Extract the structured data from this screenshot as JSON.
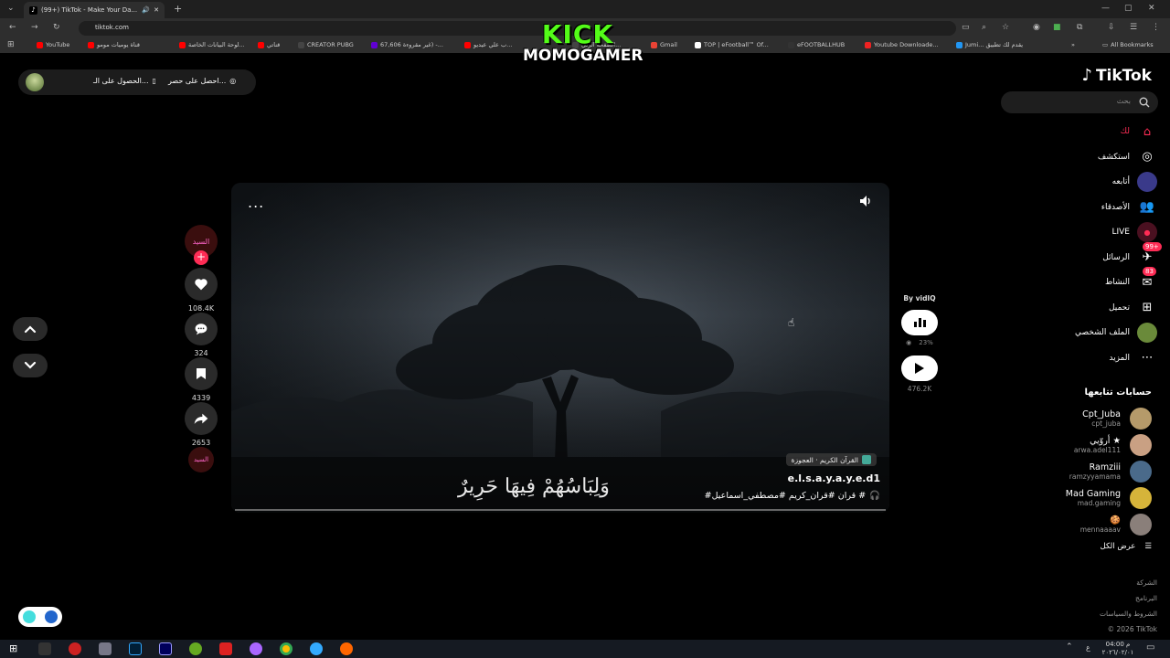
{
  "browser": {
    "tab_title": "(99+) TikTok - Make Your Da...",
    "url": "tiktok.com",
    "bookmarks": [
      {
        "label": "YouTube",
        "color": "#ff0000"
      },
      {
        "label": "قناة يوميات مومو",
        "color": "#ff0000"
      },
      {
        "label": "لوحة البيانات الخاصة...",
        "color": "#ff0000"
      },
      {
        "label": "قناتي",
        "color": "#ff0000"
      },
      {
        "label": "CREATOR PUBG",
        "color": "#444444"
      },
      {
        "label": "67,606 غير مقروءة) -...",
        "color": "#6001d2"
      },
      {
        "label": "ب علي عيديو...",
        "color": "#ff0000"
      },
      {
        "label": "الصفحة الرئي...",
        "color": "#444444"
      },
      {
        "label": "Gmail",
        "color": "#ea4335"
      },
      {
        "label": "TOP | eFootball™ Of...",
        "color": "#ffffff"
      },
      {
        "label": "eFOOTBALLHUB",
        "color": "#333333"
      },
      {
        "label": "Youtube Downloade...",
        "color": "#e22"
      },
      {
        "label": "Jumi... يقدم لك تطبيق",
        "color": "#2196f3"
      }
    ],
    "all_bookmarks": "All Bookmarks"
  },
  "overlay": {
    "kick_text": "KICK",
    "gamer_text": "MOMOGAMER"
  },
  "top_bar": {
    "item1": "احصل على حصر...",
    "item2": "الحصول على الـ..."
  },
  "video": {
    "hashtag_chip": "القرآن الكريم · العجوزة",
    "username": "e.l.s.a.y.a.y.e.d1",
    "caption": "#قران #قران_كريم #مصطفي_اسماعيل #",
    "arabic_overlay": "وَلِبَاسُهُمْ فِيهَا حَرِيرٌ",
    "more_label": "..."
  },
  "actions": {
    "creator_label": "السيد",
    "likes": "108.4K",
    "comments": "324",
    "saves": "4339",
    "shares": "2653",
    "music_label": "السيد"
  },
  "vidiq": {
    "by_label": "By vidIQ",
    "percent": "23%",
    "views": "476.2K"
  },
  "sidebar": {
    "logo": "TikTok",
    "search_placeholder": "بحث",
    "nav": [
      {
        "label": "لك",
        "icon": "home-icon",
        "active": true
      },
      {
        "label": "استكشف",
        "icon": "compass-icon"
      },
      {
        "label": "أتابعه",
        "icon": "following-icon"
      },
      {
        "label": "الأصدقاء",
        "icon": "friends-icon"
      },
      {
        "label": "LIVE",
        "icon": "live-icon"
      },
      {
        "label": "الرسائل",
        "icon": "messages-icon",
        "badge": "99+"
      },
      {
        "label": "النشاط",
        "icon": "activity-icon",
        "badge": "83"
      },
      {
        "label": "تحميل",
        "icon": "upload-icon"
      },
      {
        "label": "الملف الشخصي",
        "icon": "profile-icon"
      },
      {
        "label": "المزيد",
        "icon": "more-icon"
      }
    ],
    "following_title": "حسابات تتابعها",
    "following": [
      {
        "name": "Cpt_Juba",
        "handle": "cpt_juba",
        "color": "#b59a6a"
      },
      {
        "name": "أروّيي ★",
        "handle": "arwa.adel111",
        "color": "#c9a083"
      },
      {
        "name": "Ramziii",
        "handle": "ramzyyamama",
        "color": "#4a6a8a"
      },
      {
        "name": "Mad Gaming",
        "handle": "mad.gaming",
        "color": "#d6b43a"
      },
      {
        "name": "🍪",
        "handle": "mennaaaav",
        "color": "#8a7f7a"
      }
    ],
    "see_all": "عرض الكل",
    "footer": [
      "الشركة",
      "البرنامج",
      "الشروط والسياسات",
      "© 2026 TikTok"
    ]
  },
  "taskbar": {
    "time": "04:00 م",
    "date": "٢٠٢٦/٠٢/٠١"
  },
  "colors": {
    "accent": "#fe2c55",
    "kick_green": "#53fc18"
  }
}
